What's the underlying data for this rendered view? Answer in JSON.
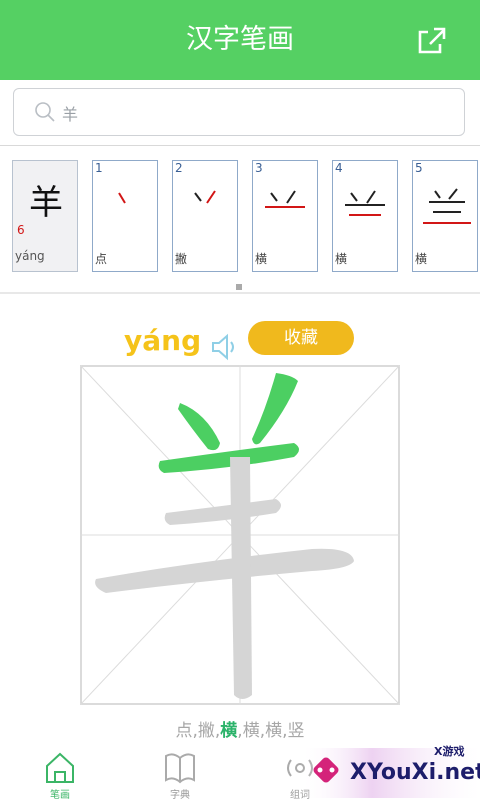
{
  "header": {
    "title": "汉字笔画"
  },
  "search": {
    "value": "羊"
  },
  "char_card": {
    "char": "羊",
    "stroke_count": "6",
    "pinyin": "yáng"
  },
  "strokes": [
    {
      "num": "1",
      "name": "点"
    },
    {
      "num": "2",
      "name": "撇"
    },
    {
      "num": "3",
      "name": "横"
    },
    {
      "num": "4",
      "name": "横"
    },
    {
      "num": "5",
      "name": "横"
    }
  ],
  "detail": {
    "pinyin": "yáng",
    "collect_label": "收藏"
  },
  "sequence": {
    "before": "点,撇,",
    "current": "横",
    "after": ",横,横,竖"
  },
  "tabs": [
    {
      "label": "笔画"
    },
    {
      "label": "字典"
    },
    {
      "label": "组词"
    }
  ],
  "watermark": {
    "small": "X游戏",
    "text": "XYouXi.net"
  },
  "colors": {
    "header": "#55d063",
    "accent": "#f0b91d",
    "pinyin": "#f5c31a",
    "stroke_red": "#d21616",
    "highlight": "#4ccf62"
  }
}
